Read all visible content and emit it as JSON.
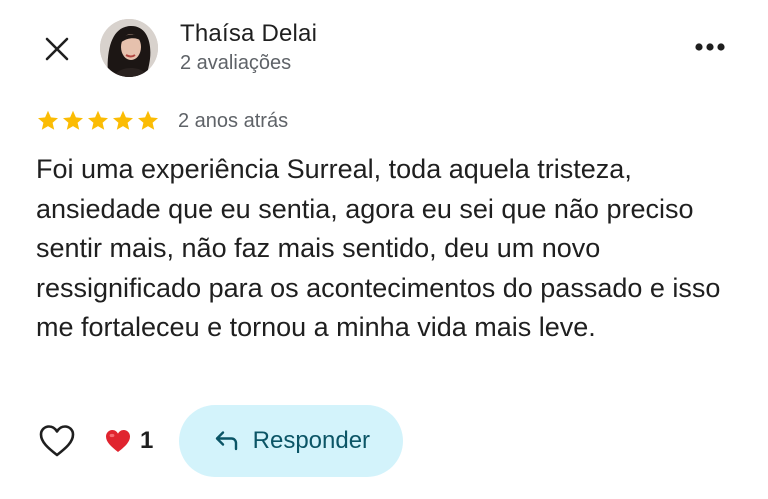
{
  "header": {
    "close_icon": "close-icon",
    "more_icon": "more-horizontal-icon"
  },
  "author": {
    "name": "Thaísa Delai",
    "reviews_count": "2 avaliações"
  },
  "review": {
    "rating": 5,
    "rating_max": 5,
    "star_color": "#fbbc04",
    "date": "2 anos atrás",
    "text": "Foi uma experiência Surreal, toda aquela tristeza, ansiedade que eu sentia, agora eu sei que não preciso sentir mais, não faz mais sentido, deu um novo ressignificado para os acontecimentos do passado e isso me fortaleceu e tornou a minha vida mais leve."
  },
  "actions": {
    "like_icon": "heart-outline-icon",
    "reaction_icon": "red-heart-icon",
    "reaction_count": "1",
    "reply_label": "Responder",
    "reply_icon": "reply-arrow-icon",
    "reply_bg": "#d3f3fb",
    "reply_text_color": "#0b5566"
  }
}
